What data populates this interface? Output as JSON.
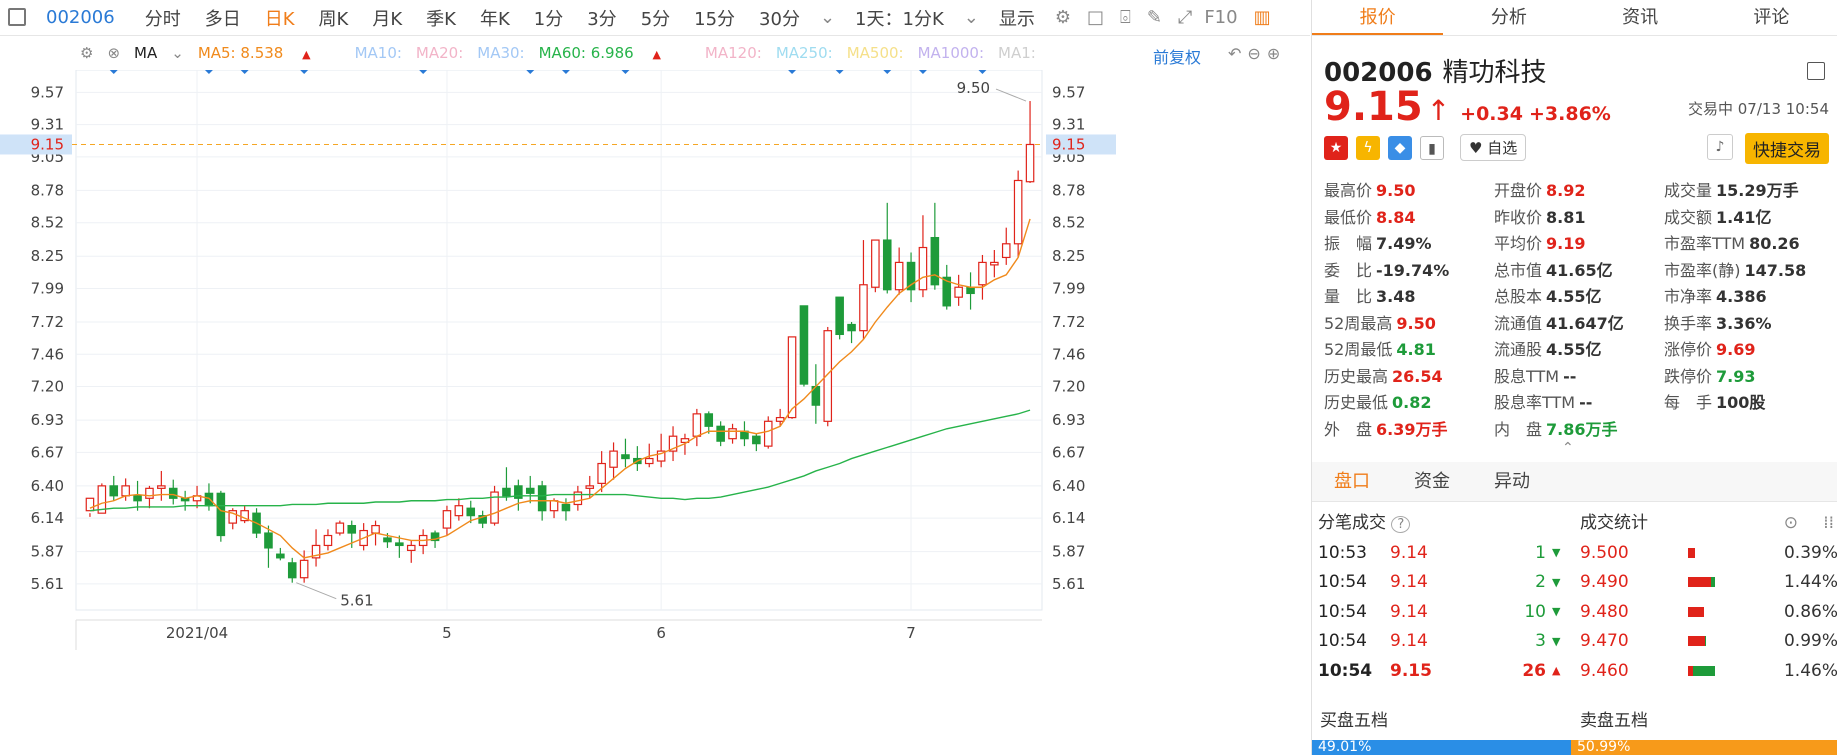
{
  "toolbar": {
    "code": "002006",
    "periods": [
      "分时",
      "多日",
      "日K",
      "周K",
      "月K",
      "季K",
      "年K",
      "1分",
      "3分",
      "5分",
      "15分",
      "30分"
    ],
    "active_period": "日K",
    "adjust": "1天：1分K",
    "display": "显示",
    "f10": "F10"
  },
  "indicators": {
    "name": "MA",
    "ma5": "MA5: 8.538",
    "ma10": "MA10:",
    "ma20": "MA20:",
    "ma30": "MA30:",
    "ma60": "MA60: 6.986",
    "ma120": "MA120:",
    "ma250": "MA250:",
    "ma500": "MA500:",
    "ma1000": "MA1000:",
    "ma1": "MA1:",
    "fuquan": "前复权",
    "colors": {
      "ma5": "#f08a1c",
      "ma10": "#a3c8f5",
      "ma20": "#f2b4c8",
      "ma30": "#a3c8f5",
      "ma60": "#27b34a",
      "ma120": "#f2b4c8",
      "ma250": "#9fdcf0",
      "ma500": "#f5e08a",
      "ma1000": "#c2b2ee",
      "ma1": "#cfcfcf"
    }
  },
  "chart_data": {
    "type": "candlestick",
    "y_ticks": [
      "9.57",
      "9.31",
      "9.05",
      "8.78",
      "8.52",
      "8.25",
      "7.99",
      "7.72",
      "7.46",
      "7.20",
      "6.93",
      "6.67",
      "6.40",
      "6.14",
      "5.87",
      "5.61"
    ],
    "ylim": [
      5.4,
      9.75
    ],
    "x_labels": [
      {
        "label": "2021/04",
        "index": 9
      },
      {
        "label": "5",
        "index": 30
      },
      {
        "label": "6",
        "index": 48
      },
      {
        "label": "7",
        "index": 69
      }
    ],
    "current_price": "9.15",
    "high_label": "9.50",
    "low_label": "5.61",
    "candles": [
      [
        6.2,
        6.3,
        6.15,
        6.18
      ],
      [
        6.18,
        6.4,
        6.18,
        6.42
      ],
      [
        6.4,
        6.32,
        6.28,
        6.48
      ],
      [
        6.32,
        6.4,
        6.28,
        6.46
      ],
      [
        6.32,
        6.28,
        6.2,
        6.44
      ],
      [
        6.3,
        6.38,
        6.22,
        6.4
      ],
      [
        6.38,
        6.4,
        6.28,
        6.52
      ],
      [
        6.38,
        6.3,
        6.25,
        6.45
      ],
      [
        6.3,
        6.28,
        6.2,
        6.36
      ],
      [
        6.28,
        6.32,
        6.22,
        6.4
      ],
      [
        6.34,
        6.24,
        6.2,
        6.42
      ],
      [
        6.34,
        6.0,
        5.95,
        6.36
      ],
      [
        6.1,
        6.2,
        6.05,
        6.22
      ],
      [
        6.12,
        6.2,
        6.1,
        6.24
      ],
      [
        6.18,
        6.02,
        5.98,
        6.22
      ],
      [
        6.02,
        5.9,
        5.74,
        6.08
      ],
      [
        5.85,
        5.82,
        5.8,
        5.9
      ],
      [
        5.78,
        5.66,
        5.62,
        5.82
      ],
      [
        5.66,
        5.8,
        5.62,
        5.88
      ],
      [
        5.82,
        5.92,
        5.75,
        6.05
      ],
      [
        5.92,
        6.0,
        5.88,
        6.05
      ],
      [
        6.02,
        6.1,
        6.0,
        6.12
      ],
      [
        6.08,
        6.02,
        5.9,
        6.12
      ],
      [
        5.92,
        6.04,
        5.88,
        6.1
      ],
      [
        6.02,
        6.08,
        5.92,
        6.12
      ],
      [
        5.98,
        5.95,
        5.9,
        6.02
      ],
      [
        5.94,
        5.92,
        5.82,
        6.0
      ],
      [
        5.88,
        5.92,
        5.78,
        5.96
      ],
      [
        5.92,
        6.0,
        5.85,
        6.05
      ],
      [
        6.02,
        5.96,
        5.9,
        6.04
      ],
      [
        6.06,
        6.2,
        6.0,
        6.24
      ],
      [
        6.16,
        6.24,
        6.12,
        6.3
      ],
      [
        6.22,
        6.16,
        6.1,
        6.28
      ],
      [
        6.16,
        6.1,
        6.06,
        6.2
      ],
      [
        6.1,
        6.35,
        6.08,
        6.4
      ],
      [
        6.38,
        6.32,
        6.28,
        6.55
      ],
      [
        6.4,
        6.3,
        6.2,
        6.45
      ],
      [
        6.38,
        6.34,
        6.26,
        6.48
      ],
      [
        6.4,
        6.2,
        6.12,
        6.44
      ],
      [
        6.2,
        6.28,
        6.14,
        6.3
      ],
      [
        6.25,
        6.2,
        6.12,
        6.3
      ],
      [
        6.25,
        6.35,
        6.2,
        6.4
      ],
      [
        6.38,
        6.4,
        6.3,
        6.48
      ],
      [
        6.42,
        6.58,
        6.35,
        6.68
      ],
      [
        6.55,
        6.68,
        6.45,
        6.75
      ],
      [
        6.65,
        6.62,
        6.55,
        6.78
      ],
      [
        6.62,
        6.58,
        6.52,
        6.72
      ],
      [
        6.58,
        6.62,
        6.55,
        6.74
      ],
      [
        6.6,
        6.68,
        6.55,
        6.82
      ],
      [
        6.68,
        6.8,
        6.6,
        6.88
      ],
      [
        6.75,
        6.78,
        6.65,
        6.82
      ],
      [
        6.8,
        6.98,
        6.72,
        7.02
      ],
      [
        6.98,
        6.88,
        6.82,
        7.0
      ],
      [
        6.88,
        6.76,
        6.72,
        6.92
      ],
      [
        6.78,
        6.86,
        6.74,
        6.9
      ],
      [
        6.84,
        6.78,
        6.72,
        6.92
      ],
      [
        6.8,
        6.74,
        6.68,
        6.82
      ],
      [
        6.72,
        6.92,
        6.7,
        6.96
      ],
      [
        6.92,
        6.95,
        6.88,
        7.02
      ],
      [
        6.95,
        7.6,
        6.94,
        7.6
      ],
      [
        7.85,
        7.22,
        7.2,
        7.85
      ],
      [
        7.2,
        7.05,
        6.9,
        7.38
      ],
      [
        6.92,
        7.65,
        6.88,
        7.68
      ],
      [
        7.92,
        7.62,
        7.58,
        7.92
      ],
      [
        7.7,
        7.65,
        7.55,
        7.72
      ],
      [
        7.65,
        8.02,
        7.58,
        8.38
      ],
      [
        8.0,
        8.38,
        7.96,
        8.38
      ],
      [
        8.38,
        7.98,
        7.95,
        8.68
      ],
      [
        7.98,
        8.2,
        7.94,
        8.32
      ],
      [
        8.2,
        7.98,
        7.88,
        8.28
      ],
      [
        7.98,
        8.32,
        7.92,
        8.58
      ],
      [
        8.4,
        8.02,
        7.98,
        8.68
      ],
      [
        8.08,
        7.85,
        7.82,
        8.18
      ],
      [
        7.92,
        8.0,
        7.85,
        8.1
      ],
      [
        8.0,
        7.95,
        7.82,
        8.12
      ],
      [
        8.02,
        8.2,
        7.9,
        8.26
      ],
      [
        8.18,
        8.2,
        8.08,
        8.3
      ],
      [
        8.24,
        8.35,
        8.18,
        8.48
      ],
      [
        8.35,
        8.86,
        8.24,
        8.94
      ],
      [
        8.85,
        9.15,
        8.84,
        9.5
      ]
    ],
    "ma5": [
      6.22,
      6.26,
      6.28,
      6.32,
      6.33,
      6.32,
      6.33,
      6.33,
      6.3,
      6.32,
      6.3,
      6.2,
      6.18,
      6.14,
      6.1,
      6.05,
      6.0,
      5.9,
      5.82,
      5.84,
      5.86,
      5.9,
      5.94,
      5.98,
      6.02,
      6.0,
      5.98,
      5.96,
      5.96,
      5.97,
      6.0,
      6.06,
      6.12,
      6.15,
      6.18,
      6.22,
      6.26,
      6.28,
      6.28,
      6.28,
      6.26,
      6.28,
      6.3,
      6.38,
      6.46,
      6.54,
      6.6,
      6.64,
      6.66,
      6.7,
      6.74,
      6.8,
      6.84,
      6.84,
      6.84,
      6.84,
      6.82,
      6.84,
      6.88,
      7.02,
      7.1,
      7.2,
      7.3,
      7.4,
      7.48,
      7.58,
      7.72,
      7.84,
      7.95,
      8.02,
      8.08,
      8.1,
      8.05,
      8.02,
      8.0,
      8.0,
      8.06,
      8.1,
      8.24,
      8.55
    ],
    "ma60": [
      6.2,
      6.21,
      6.22,
      6.22,
      6.23,
      6.23,
      6.23,
      6.23,
      6.24,
      6.24,
      6.24,
      6.24,
      6.24,
      6.24,
      6.24,
      6.24,
      6.24,
      6.25,
      6.25,
      6.25,
      6.26,
      6.26,
      6.26,
      6.26,
      6.27,
      6.27,
      6.27,
      6.28,
      6.28,
      6.28,
      6.29,
      6.29,
      6.3,
      6.3,
      6.31,
      6.31,
      6.32,
      6.32,
      6.32,
      6.33,
      6.33,
      6.33,
      6.33,
      6.33,
      6.33,
      6.33,
      6.32,
      6.31,
      6.3,
      6.3,
      6.29,
      6.3,
      6.3,
      6.31,
      6.33,
      6.35,
      6.37,
      6.39,
      6.42,
      6.45,
      6.48,
      6.52,
      6.55,
      6.58,
      6.62,
      6.65,
      6.68,
      6.71,
      6.74,
      6.77,
      6.8,
      6.83,
      6.86,
      6.88,
      6.9,
      6.92,
      6.94,
      6.96,
      6.98,
      7.01
    ],
    "markers": [
      2,
      10,
      13,
      18,
      28,
      37,
      40,
      45,
      59,
      63,
      67,
      70,
      75
    ]
  },
  "panel": {
    "tabs": [
      "报价",
      "分析",
      "资讯",
      "评论"
    ],
    "active_tab": "报价",
    "code": "002006",
    "name": "精功科技",
    "price": "9.15",
    "arrow": "↑",
    "change": "+0.34",
    "change_pct": "+3.86%",
    "status": "交易中 07/13 10:54",
    "zixuan": "自选",
    "quick_trade": "快捷交易",
    "stats": [
      [
        {
          "l": "最高价",
          "v": "9.50",
          "c": "red"
        },
        {
          "l": "开盘价",
          "v": "8.92",
          "c": "red"
        },
        {
          "l": "成交量",
          "v": "15.29万手",
          "c": "dark"
        }
      ],
      [
        {
          "l": "最低价",
          "v": "8.84",
          "c": "red"
        },
        {
          "l": "昨收价",
          "v": "8.81",
          "c": "dark"
        },
        {
          "l": "成交额",
          "v": "1.41亿",
          "c": "dark"
        }
      ],
      [
        {
          "l": "振　幅",
          "v": "7.49%",
          "c": "dark"
        },
        {
          "l": "平均价",
          "v": "9.19",
          "c": "red"
        },
        {
          "l": "市盈率TTM",
          "v": "80.26",
          "c": "dark"
        }
      ],
      [
        {
          "l": "委　比",
          "v": "-19.74%",
          "c": "dark"
        },
        {
          "l": "总市值",
          "v": "41.65亿",
          "c": "dark"
        },
        {
          "l": "市盈率(静)",
          "v": "147.58",
          "c": "dark"
        }
      ],
      [
        {
          "l": "量　比",
          "v": "3.48",
          "c": "dark"
        },
        {
          "l": "总股本",
          "v": "4.55亿",
          "c": "dark"
        },
        {
          "l": "市净率",
          "v": "4.386",
          "c": "dark"
        }
      ],
      [
        {
          "l": "52周最高",
          "v": "9.50",
          "c": "red"
        },
        {
          "l": "流通值",
          "v": "41.647亿",
          "c": "dark"
        },
        {
          "l": "换手率",
          "v": "3.36%",
          "c": "dark"
        }
      ],
      [
        {
          "l": "52周最低",
          "v": "4.81",
          "c": "green"
        },
        {
          "l": "流通股",
          "v": "4.55亿",
          "c": "dark"
        },
        {
          "l": "涨停价",
          "v": "9.69",
          "c": "red"
        }
      ],
      [
        {
          "l": "历史最高",
          "v": "26.54",
          "c": "red"
        },
        {
          "l": "股息TTM",
          "v": "--",
          "c": "dark"
        },
        {
          "l": "跌停价",
          "v": "7.93",
          "c": "green"
        }
      ],
      [
        {
          "l": "历史最低",
          "v": "0.82",
          "c": "green"
        },
        {
          "l": "股息率TTM",
          "v": "--",
          "c": "dark"
        },
        {
          "l": "每　手",
          "v": "100股",
          "c": "dark"
        }
      ],
      [
        {
          "l": "外　盘",
          "v": "6.39万手",
          "c": "red"
        },
        {
          "l": "内　盘",
          "v": "7.86万手",
          "c": "green"
        },
        {
          "l": "",
          "v": "",
          "c": "dark"
        }
      ]
    ],
    "subtabs": [
      "盘口",
      "资金",
      "异动"
    ],
    "ticks_title": "分笔成交",
    "ticks": [
      {
        "t": "10:53",
        "p": "9.14",
        "v": "1",
        "d": "down"
      },
      {
        "t": "10:54",
        "p": "9.14",
        "v": "2",
        "d": "down"
      },
      {
        "t": "10:54",
        "p": "9.14",
        "v": "10",
        "d": "down"
      },
      {
        "t": "10:54",
        "p": "9.14",
        "v": "3",
        "d": "down"
      },
      {
        "t": "10:54",
        "p": "9.15",
        "v": "26",
        "d": "up"
      }
    ],
    "trade_title": "成交统计",
    "trades": [
      {
        "p": "9.500",
        "pct": "0.39%",
        "w": 0.08,
        "g": 0
      },
      {
        "p": "9.490",
        "pct": "1.44%",
        "w": 0.3,
        "g": 0.15
      },
      {
        "p": "9.480",
        "pct": "0.86%",
        "w": 0.18,
        "g": 0
      },
      {
        "p": "9.470",
        "pct": "0.99%",
        "w": 0.2,
        "g": 0.08
      },
      {
        "p": "9.460",
        "pct": "1.46%",
        "w": 0.3,
        "g": 0.8
      }
    ],
    "buy5": "买盘五档",
    "sell5": "卖盘五档",
    "buy_pct": "49.01%",
    "sell_pct": "50.99%"
  }
}
